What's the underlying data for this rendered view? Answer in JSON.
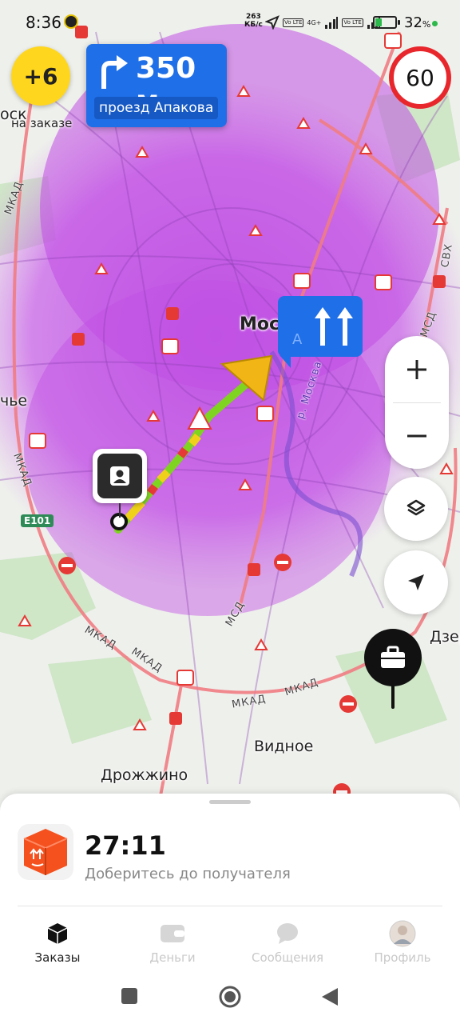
{
  "status_bar": {
    "time": "8:36",
    "net_speed_value": "263",
    "net_speed_unit": "КБ/с",
    "lte_1": "Vo LTE",
    "lte_2": "Vo LTE",
    "network_4g": "4G+",
    "battery_percent": "32",
    "battery_unit": "%",
    "battery_level": 0.32
  },
  "map": {
    "bonus_badge": "+6",
    "on_order_label": "на заказе",
    "maneuver": {
      "distance": "350 м",
      "street": "проезд Апакова"
    },
    "speed_limit": "60",
    "lane_label": "А",
    "labels": {
      "moscow": "Моск",
      "vidnoe": "Видное",
      "drozhzhino": "Дрожжино",
      "dzer": "Дзер",
      "left_cut_1": "оск",
      "left_cut_2": "чье",
      "river": "р. Москва"
    },
    "roads": {
      "mkad": "МКАД",
      "mcd": "МСД",
      "svh": "СВХ",
      "e101": "E101"
    }
  },
  "sheet": {
    "eta": "27:11",
    "eta_subtitle": "Доберитесь до получателя"
  },
  "tabs": [
    {
      "label": "Заказы",
      "icon": "box-icon",
      "active": true
    },
    {
      "label": "Деньги",
      "icon": "wallet-icon",
      "active": false
    },
    {
      "label": "Сообщения",
      "icon": "chat-icon",
      "active": false
    },
    {
      "label": "Профиль",
      "icon": "avatar-icon",
      "active": false
    }
  ],
  "colors": {
    "route_blue": "#1f6fe8",
    "traffic_overlay": "#c44ee6",
    "speed_limit_red": "#e8272d",
    "bonus_yellow": "#ffd61e",
    "order_orange": "#f4511e"
  }
}
